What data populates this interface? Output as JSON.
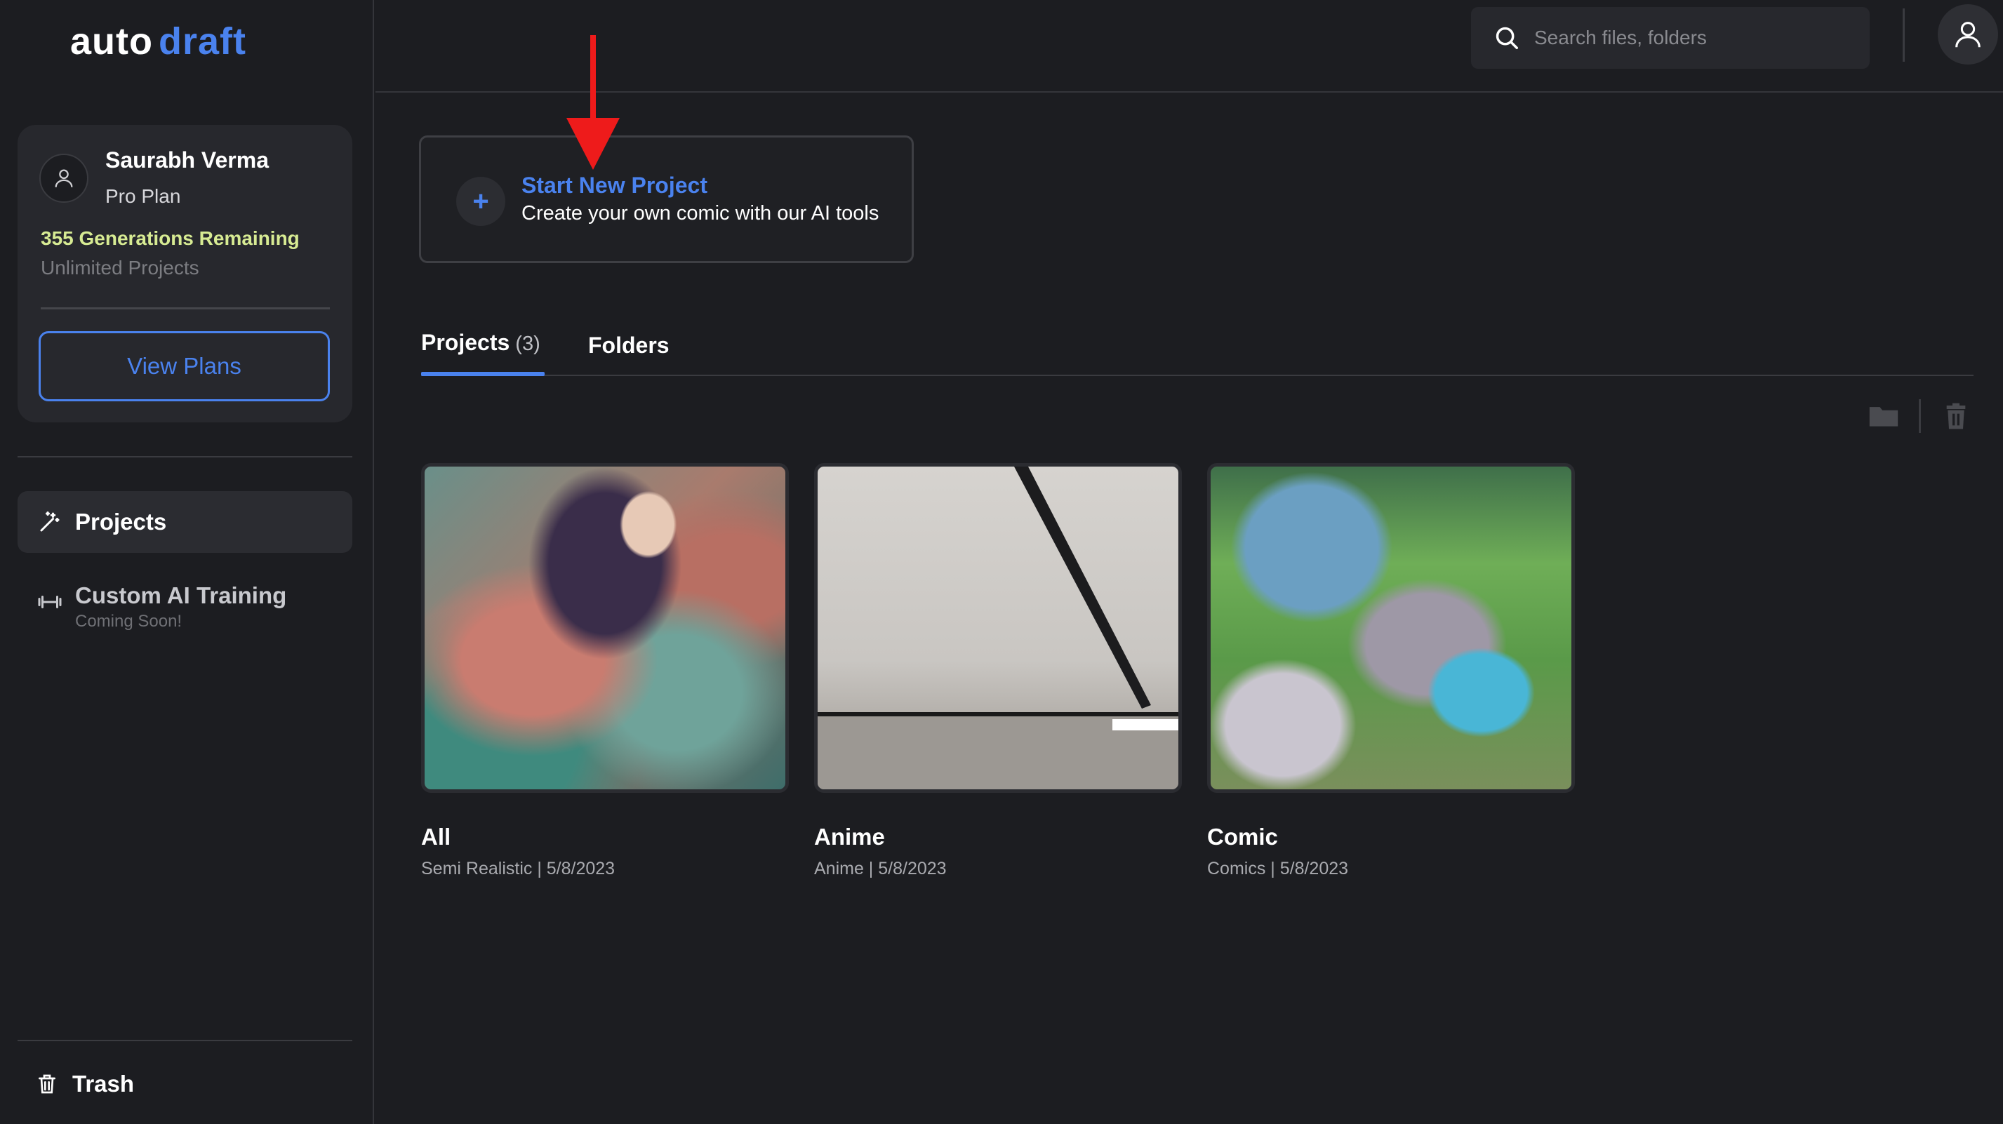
{
  "brand": {
    "word1": "auto",
    "word2": "draft"
  },
  "profile": {
    "name": "Saurabh Verma",
    "plan": "Pro Plan",
    "generations": "355 Generations Remaining",
    "projects_limit": "Unlimited Projects",
    "view_plans_label": "View Plans"
  },
  "sidebar": {
    "projects_label": "Projects",
    "custom_training_label": "Custom AI Training",
    "custom_training_sub": "Coming Soon!",
    "trash_label": "Trash"
  },
  "header": {
    "search_placeholder": "Search files, folders"
  },
  "start_project": {
    "title": "Start New Project",
    "subtitle": "Create your own comic with our AI tools"
  },
  "tabs": {
    "projects_label": "Projects",
    "projects_count": "(3)",
    "folders_label": "Folders"
  },
  "projects": [
    {
      "title": "All",
      "meta": "Semi Realistic | 5/8/2023"
    },
    {
      "title": "Anime",
      "meta": "Anime | 5/8/2023"
    },
    {
      "title": "Comic",
      "meta": "Comics | 5/8/2023"
    }
  ],
  "colors": {
    "accent": "#4a82ee",
    "highlight": "#d7eb93",
    "background": "#1c1d21"
  }
}
